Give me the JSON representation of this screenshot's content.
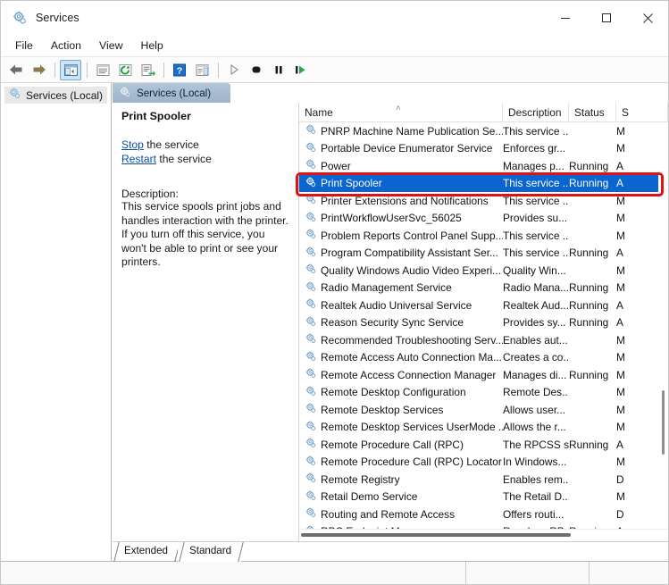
{
  "window": {
    "title": "Services",
    "icon": "services-gear-icon",
    "controls": {
      "minimize": "minimize-button",
      "maximize": "maximize-button",
      "close": "close-button"
    }
  },
  "menubar": {
    "items": [
      {
        "label": "File"
      },
      {
        "label": "Action"
      },
      {
        "label": "View"
      },
      {
        "label": "Help"
      }
    ]
  },
  "toolbar": {
    "buttons": [
      {
        "name": "back-icon",
        "tooltip": "Back"
      },
      {
        "name": "forward-icon",
        "tooltip": "Forward"
      },
      {
        "name": "show-hide-console-tree-icon",
        "tooltip": "Show/Hide Console Tree"
      },
      {
        "name": "properties-icon",
        "tooltip": "Properties"
      },
      {
        "name": "refresh-icon",
        "tooltip": "Refresh"
      },
      {
        "name": "export-list-icon",
        "tooltip": "Export List"
      },
      {
        "name": "help-icon",
        "tooltip": "Help"
      },
      {
        "name": "show-hide-action-pane-icon",
        "tooltip": "Show/Hide Action Pane"
      },
      {
        "name": "start-service-icon",
        "tooltip": "Start Service"
      },
      {
        "name": "stop-service-icon",
        "tooltip": "Stop Service"
      },
      {
        "name": "pause-service-icon",
        "tooltip": "Pause Service"
      },
      {
        "name": "restart-service-icon",
        "tooltip": "Restart Service"
      }
    ]
  },
  "tree": {
    "items": [
      {
        "label": "Services (Local)",
        "icon": "services-gear-icon",
        "selected": true
      }
    ]
  },
  "console": {
    "tab_label": "Services (Local)",
    "tab_icon": "services-gear-icon"
  },
  "detail": {
    "title": "Print Spooler",
    "links": [
      {
        "link": "Stop",
        "suffix": " the service"
      },
      {
        "link": "Restart",
        "suffix": " the service"
      }
    ],
    "description_heading": "Description:",
    "description_body": "This service spools print jobs and handles interaction with the printer. If you turn off this service, you won't be able to print or see your printers."
  },
  "list": {
    "columns": [
      {
        "key": "name",
        "label": "Name",
        "sorted": true,
        "sort_caret": "˄"
      },
      {
        "key": "description",
        "label": "Description"
      },
      {
        "key": "status",
        "label": "Status"
      },
      {
        "key": "startup",
        "label": "S"
      }
    ],
    "rows": [
      {
        "name": "PNRP Machine Name Publication Se...",
        "description": "This service ...",
        "status": "",
        "startup": "M"
      },
      {
        "name": "Portable Device Enumerator Service",
        "description": "Enforces gr...",
        "status": "",
        "startup": "M"
      },
      {
        "name": "Power",
        "description": "Manages p...",
        "status": "Running",
        "startup": "A"
      },
      {
        "name": "Print Spooler",
        "description": "This service ...",
        "status": "Running",
        "startup": "A",
        "selected": true
      },
      {
        "name": "Printer Extensions and Notifications",
        "description": "This service ...",
        "status": "",
        "startup": "M"
      },
      {
        "name": "PrintWorkflowUserSvc_56025",
        "description": "Provides su...",
        "status": "",
        "startup": "M"
      },
      {
        "name": "Problem Reports Control Panel Supp...",
        "description": "This service ...",
        "status": "",
        "startup": "M"
      },
      {
        "name": "Program Compatibility Assistant Ser...",
        "description": "This service ...",
        "status": "Running",
        "startup": "A"
      },
      {
        "name": "Quality Windows Audio Video Experi...",
        "description": "Quality Win...",
        "status": "",
        "startup": "M"
      },
      {
        "name": "Radio Management Service",
        "description": "Radio Mana...",
        "status": "Running",
        "startup": "M"
      },
      {
        "name": "Realtek Audio Universal Service",
        "description": "Realtek Aud...",
        "status": "Running",
        "startup": "A"
      },
      {
        "name": "Reason Security Sync Service",
        "description": "Provides sy...",
        "status": "Running",
        "startup": "A"
      },
      {
        "name": "Recommended Troubleshooting Serv...",
        "description": "Enables aut...",
        "status": "",
        "startup": "M"
      },
      {
        "name": "Remote Access Auto Connection Ma...",
        "description": "Creates a co...",
        "status": "",
        "startup": "M"
      },
      {
        "name": "Remote Access Connection Manager",
        "description": "Manages di...",
        "status": "Running",
        "startup": "M"
      },
      {
        "name": "Remote Desktop Configuration",
        "description": "Remote Des...",
        "status": "",
        "startup": "M"
      },
      {
        "name": "Remote Desktop Services",
        "description": "Allows user...",
        "status": "",
        "startup": "M"
      },
      {
        "name": "Remote Desktop Services UserMode ...",
        "description": "Allows the r...",
        "status": "",
        "startup": "M"
      },
      {
        "name": "Remote Procedure Call (RPC)",
        "description": "The RPCSS s...",
        "status": "Running",
        "startup": "A"
      },
      {
        "name": "Remote Procedure Call (RPC) Locator",
        "description": "In Windows...",
        "status": "",
        "startup": "M"
      },
      {
        "name": "Remote Registry",
        "description": "Enables rem...",
        "status": "",
        "startup": "D"
      },
      {
        "name": "Retail Demo Service",
        "description": "The Retail D...",
        "status": "",
        "startup": "M"
      },
      {
        "name": "Routing and Remote Access",
        "description": "Offers routi...",
        "status": "",
        "startup": "D"
      },
      {
        "name": "RPC Endpoint Mapper",
        "description": "Resolves RP...",
        "status": "Running",
        "startup": "A"
      }
    ]
  },
  "tabs": {
    "items": [
      {
        "label": "Extended",
        "active": false
      },
      {
        "label": "Standard",
        "active": true
      }
    ]
  },
  "statusbar": {
    "segments": [
      "",
      "",
      ""
    ]
  },
  "annotation": {
    "color": "#e31010",
    "target": "Print Spooler"
  },
  "colors": {
    "selection_blue": "#0a65d0",
    "console_tab_blue": "#9db4cb",
    "link_blue": "#0b4ea2",
    "annotation_red": "#e31010"
  }
}
